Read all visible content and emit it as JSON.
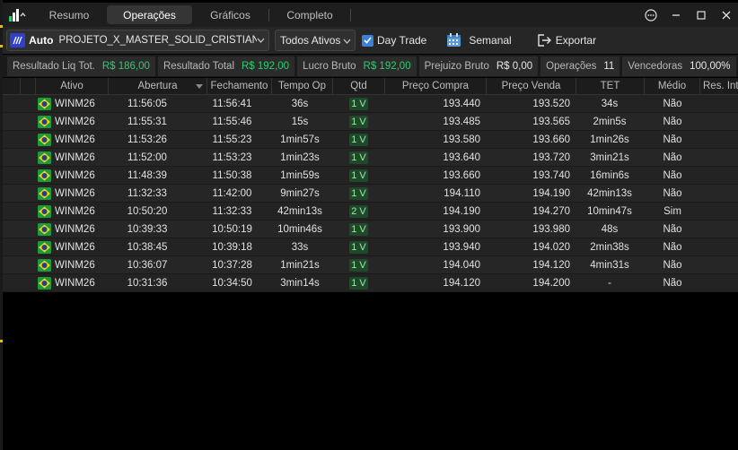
{
  "tabs": [
    {
      "label": "Resumo"
    },
    {
      "label": "Operações",
      "active": true
    },
    {
      "label": "Gráficos"
    },
    {
      "label": "Completo"
    }
  ],
  "toolbar": {
    "account_mode": "Auto",
    "account_name": "PROJETO_X_MASTER_SOLID_CRISTIANO_FU",
    "asset_filter": "Todos Ativos",
    "day_trade_label": "Day Trade",
    "day_trade_checked": true,
    "period_label": "Semanal",
    "export_label": "Exportar"
  },
  "summary": [
    {
      "label": "Resultado Liq Tot.",
      "value": "R$ 186,00",
      "color": "#2ecc71"
    },
    {
      "label": "Resultado Total",
      "value": "R$ 192,00",
      "color": "#2ecc71"
    },
    {
      "label": "Lucro Bruto",
      "value": "R$ 192,00",
      "color": "#2ecc71"
    },
    {
      "label": "Prejuizo Bruto",
      "value": "R$ 0,00",
      "color": "#e6e6e6"
    },
    {
      "label": "Operações",
      "value": "11",
      "color": "#e6e6e6"
    },
    {
      "label": "Vencedoras",
      "value": "100,00%",
      "color": "#e6e6e6"
    }
  ],
  "columns": [
    "Ativo",
    "Abertura",
    "Fechamento",
    "Tempo Op",
    "Qtd",
    "Preço Compra",
    "Preço Venda",
    "TET",
    "Médio",
    "Res. Intervalo"
  ],
  "rows": [
    {
      "ativo": "WINM26",
      "abertura": "11:56:05",
      "fechamento": "11:56:41",
      "tempo": "36s",
      "qtd": "1 V",
      "compra": "193.440",
      "venda": "193.520",
      "tet": "34s",
      "medio": "Não"
    },
    {
      "ativo": "WINM26",
      "abertura": "11:55:31",
      "fechamento": "11:55:46",
      "tempo": "15s",
      "qtd": "1 V",
      "compra": "193.485",
      "venda": "193.565",
      "tet": "2min5s",
      "medio": "Não"
    },
    {
      "ativo": "WINM26",
      "abertura": "11:53:26",
      "fechamento": "11:55:23",
      "tempo": "1min57s",
      "qtd": "1 V",
      "compra": "193.580",
      "venda": "193.660",
      "tet": "1min26s",
      "medio": "Não"
    },
    {
      "ativo": "WINM26",
      "abertura": "11:52:00",
      "fechamento": "11:53:23",
      "tempo": "1min23s",
      "qtd": "1 V",
      "compra": "193.640",
      "venda": "193.720",
      "tet": "3min21s",
      "medio": "Não"
    },
    {
      "ativo": "WINM26",
      "abertura": "11:48:39",
      "fechamento": "11:50:38",
      "tempo": "1min59s",
      "qtd": "1 V",
      "compra": "193.660",
      "venda": "193.740",
      "tet": "16min6s",
      "medio": "Não"
    },
    {
      "ativo": "WINM26",
      "abertura": "11:32:33",
      "fechamento": "11:42:00",
      "tempo": "9min27s",
      "qtd": "1 V",
      "compra": "194.110",
      "venda": "194.190",
      "tet": "42min13s",
      "medio": "Não"
    },
    {
      "ativo": "WINM26",
      "abertura": "10:50:20",
      "fechamento": "11:32:33",
      "tempo": "42min13s",
      "qtd": "2 V",
      "compra": "194.190",
      "venda": "194.270",
      "tet": "10min47s",
      "medio": "Sim"
    },
    {
      "ativo": "WINM26",
      "abertura": "10:39:33",
      "fechamento": "10:50:19",
      "tempo": "10min46s",
      "qtd": "1 V",
      "compra": "193.900",
      "venda": "193.980",
      "tet": "48s",
      "medio": "Não"
    },
    {
      "ativo": "WINM26",
      "abertura": "10:38:45",
      "fechamento": "10:39:18",
      "tempo": "33s",
      "qtd": "1 V",
      "compra": "193.940",
      "venda": "194.020",
      "tet": "2min38s",
      "medio": "Não"
    },
    {
      "ativo": "WINM26",
      "abertura": "10:36:07",
      "fechamento": "10:37:28",
      "tempo": "1min21s",
      "qtd": "1 V",
      "compra": "194.040",
      "venda": "194.120",
      "tet": "4min31s",
      "medio": "Não"
    },
    {
      "ativo": "WINM26",
      "abertura": "10:31:36",
      "fechamento": "10:34:50",
      "tempo": "3min14s",
      "qtd": "1 V",
      "compra": "194.120",
      "venda": "194.200",
      "tet": "-",
      "medio": "Não"
    }
  ]
}
